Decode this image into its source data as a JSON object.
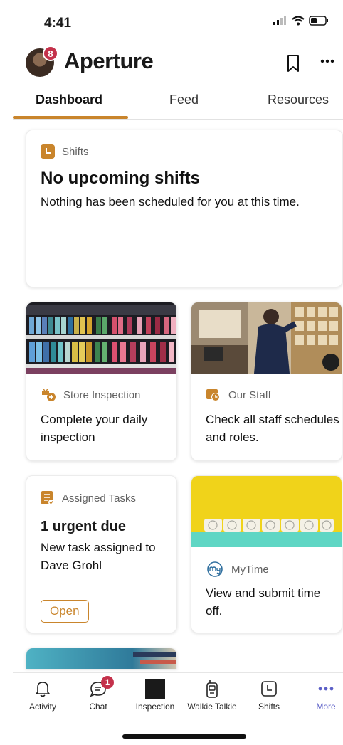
{
  "status_bar": {
    "time": "4:41"
  },
  "header": {
    "title": "Aperture",
    "avatar_badge": "8"
  },
  "tabs": [
    {
      "label": "Dashboard",
      "active": true
    },
    {
      "label": "Feed",
      "active": false
    },
    {
      "label": "Resources",
      "active": false
    }
  ],
  "shifts_card": {
    "label": "Shifts",
    "title": "No upcoming shifts",
    "text": "Nothing has been scheduled for you at this time."
  },
  "inspection_card": {
    "label": "Store Inspection",
    "text": "Complete your daily inspection"
  },
  "staff_card": {
    "label": "Our Staff",
    "text": "Check all staff schedules and roles."
  },
  "tasks_card": {
    "label": "Assigned Tasks",
    "title": "1 urgent due",
    "text": "New task assigned to Dave Grohl",
    "button": "Open"
  },
  "mytime_card": {
    "label": "MyTime",
    "text": "View and submit time off."
  },
  "bottom_nav": [
    {
      "label": "Activity",
      "icon": "bell-icon"
    },
    {
      "label": "Chat",
      "icon": "chat-icon",
      "badge": "1"
    },
    {
      "label": "Inspection",
      "icon": "inspection-icon"
    },
    {
      "label": "Walkie Talkie",
      "icon": "walkie-talkie-icon"
    },
    {
      "label": "Shifts",
      "icon": "clock-icon"
    },
    {
      "label": "More",
      "icon": "more-icon"
    }
  ],
  "colors": {
    "accent": "#c9852c",
    "badge": "#c4314b",
    "more": "#5b5fc7"
  }
}
